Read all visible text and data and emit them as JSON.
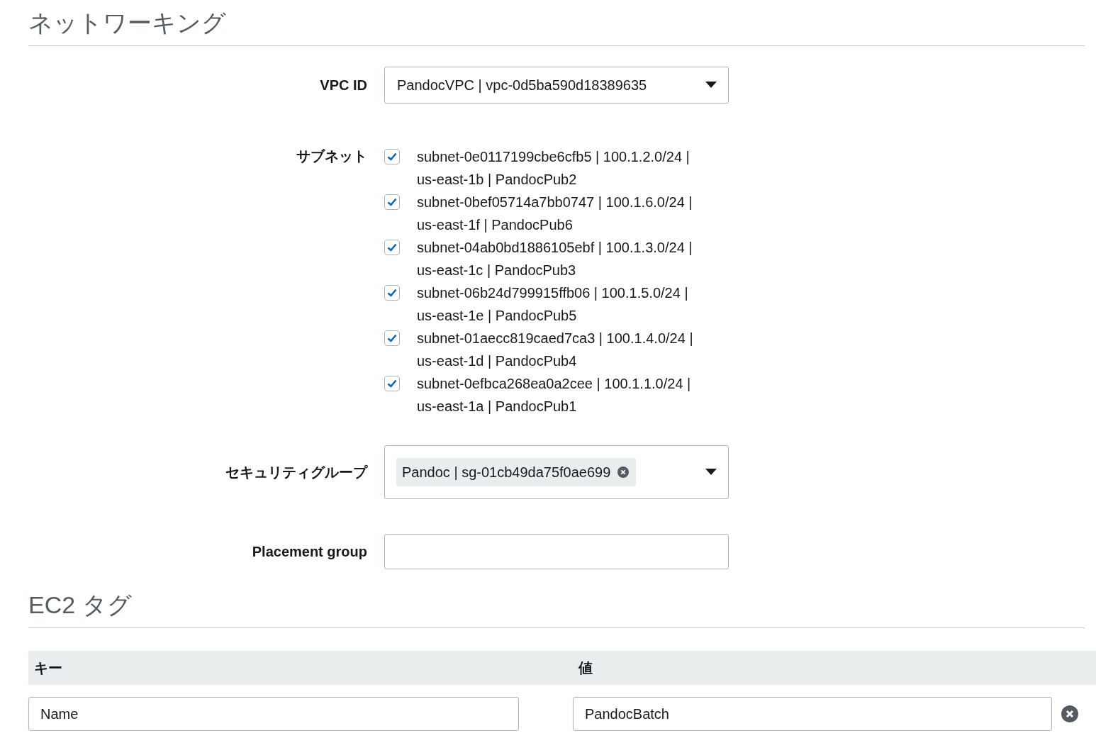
{
  "networking": {
    "title": "ネットワーキング",
    "vpc": {
      "label": "VPC ID",
      "value": "PandocVPC | vpc-0d5ba590d18389635"
    },
    "subnets": {
      "label": "サブネット",
      "items": [
        {
          "text": "subnet-0e0117199cbe6cfb5 | 100.1.2.0/24 | us-east-1b | PandocPub2",
          "checked": true
        },
        {
          "text": "subnet-0bef05714a7bb0747 | 100.1.6.0/24 | us-east-1f | PandocPub6",
          "checked": true
        },
        {
          "text": "subnet-04ab0bd1886105ebf | 100.1.3.0/24 | us-east-1c | PandocPub3",
          "checked": true
        },
        {
          "text": "subnet-06b24d799915ffb06 | 100.1.5.0/24 | us-east-1e | PandocPub5",
          "checked": true
        },
        {
          "text": "subnet-01aecc819caed7ca3 | 100.1.4.0/24 | us-east-1d | PandocPub4",
          "checked": true
        },
        {
          "text": "subnet-0efbca268ea0a2cee | 100.1.1.0/24 | us-east-1a | PandocPub1",
          "checked": true
        }
      ]
    },
    "security_groups": {
      "label": "セキュリティグループ",
      "tokens": [
        "Pandoc | sg-01cb49da75f0ae699"
      ]
    },
    "placement_group": {
      "label": "Placement group"
    }
  },
  "tags": {
    "title": "EC2 タグ",
    "columns": [
      "キー",
      "値"
    ],
    "rows": [
      {
        "key": "Name",
        "value": "PandocBatch"
      }
    ]
  }
}
